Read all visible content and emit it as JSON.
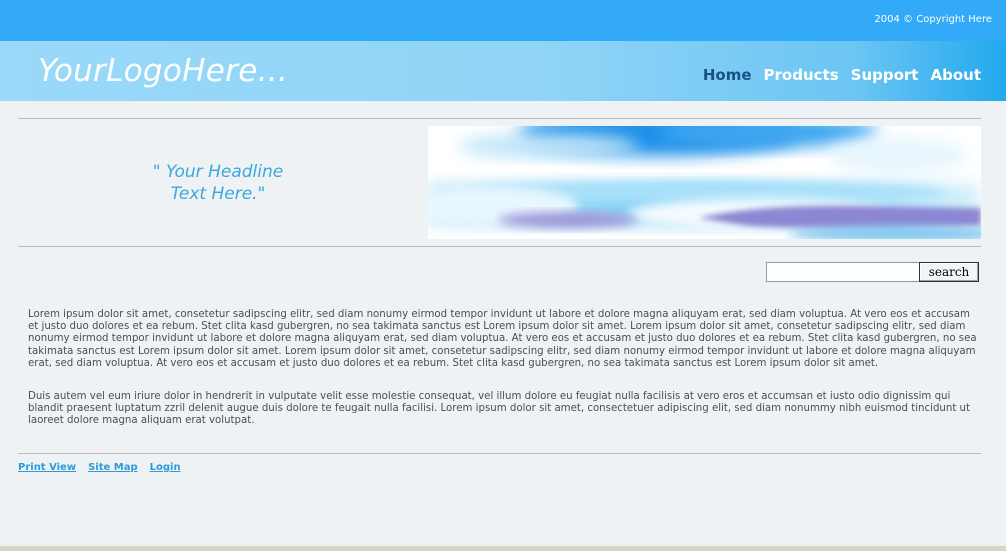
{
  "header": {
    "copyright": "2004 © Copyright Here",
    "logo": "YourLogoHere...",
    "nav": [
      "Home",
      "Products",
      "Support",
      "About"
    ]
  },
  "hero": {
    "headline_line1": "\" Your Headline",
    "headline_line2": "Text Here.\""
  },
  "search": {
    "value": "",
    "button_label": "search"
  },
  "content": {
    "paragraph1": "Lorem ipsum dolor sit amet, consetetur sadipscing elitr,  sed diam nonumy eirmod tempor invidunt ut labore et dolore magna aliquyam erat, sed diam voluptua. At vero eos et accusam et justo duo dolores et ea rebum. Stet clita kasd gubergren, no sea takimata sanctus est Lorem ipsum dolor sit amet. Lorem ipsum dolor sit amet, consetetur sadipscing elitr,  sed diam nonumy eirmod tempor invidunt ut labore et dolore magna aliquyam erat, sed diam voluptua. At vero eos et accusam et justo duo dolores et ea rebum. Stet clita kasd gubergren, no sea takimata sanctus est Lorem ipsum dolor sit amet. Lorem ipsum dolor sit amet, consetetur sadipscing elitr,  sed diam nonumy eirmod tempor invidunt ut labore et dolore magna aliquyam erat, sed diam voluptua. At vero eos et accusam et justo duo dolores et ea rebum. Stet clita kasd gubergren, no sea takimata sanctus est Lorem ipsum dolor sit amet.",
    "paragraph2": "Duis autem vel eum iriure dolor in hendrerit in vulputate velit esse molestie consequat, vel illum dolore eu feugiat nulla facilisis at vero eros et accumsan et iusto odio dignissim qui blandit praesent luptatum zzril delenit augue duis dolore te feugait nulla facilisi. Lorem ipsum dolor sit amet, consectetuer adipiscing elit, sed diam nonummy nibh euismod tincidunt ut laoreet dolore magna aliquam erat volutpat."
  },
  "footer": {
    "links": [
      "Print View",
      "Site Map",
      "Login"
    ]
  },
  "colors": {
    "topbar": "#33aaf7",
    "header_gradient_end": "#22a9ee",
    "nav_active": "#1d4f86",
    "headline": "#3aa7df",
    "footer_link": "#2f9ad8"
  }
}
